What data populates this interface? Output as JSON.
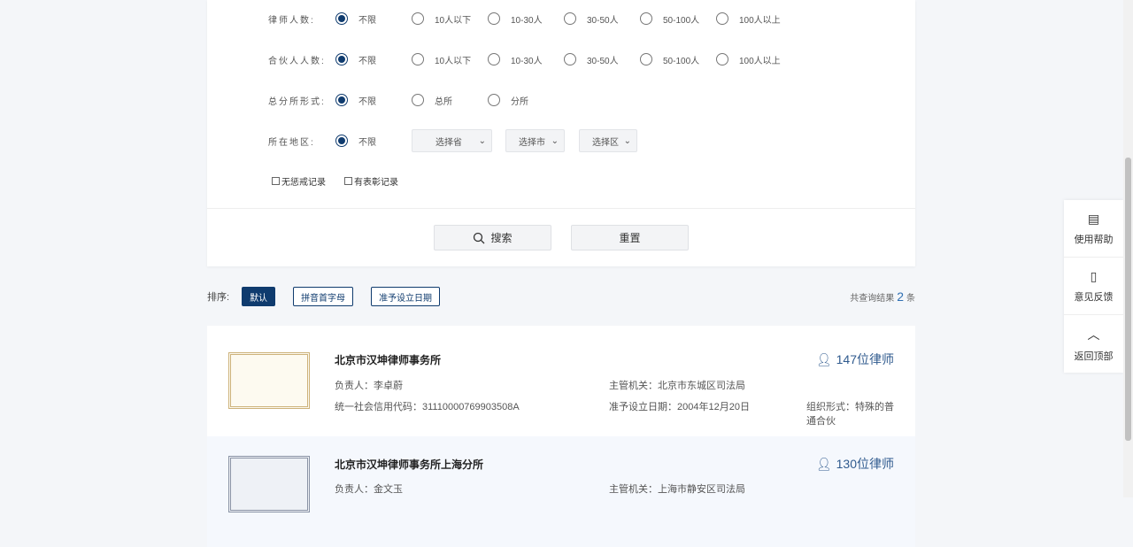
{
  "filters": [
    {
      "label": "律师人数:",
      "options": [
        "不限",
        "10人以下",
        "10-30人",
        "30-50人",
        "50-100人",
        "100人以上"
      ]
    },
    {
      "label": "合伙人人数:",
      "options": [
        "不限",
        "10人以下",
        "10-30人",
        "30-50人",
        "50-100人",
        "100人以上"
      ]
    },
    {
      "label": "总分所形式:",
      "options": [
        "不限",
        "总所",
        "分所"
      ]
    }
  ],
  "region": {
    "label": "所在地区:",
    "option": "不限",
    "province": "选择省",
    "city": "选择市",
    "district": "选择区"
  },
  "checks": [
    "无惩戒记录",
    "有表彰记录"
  ],
  "search_label": "搜索",
  "reset_label": "重置",
  "sort": {
    "label": "排序:",
    "options": [
      "默认",
      "拼音首字母",
      "准予设立日期"
    ],
    "total_prefix": "共查询结果",
    "total": "2",
    "total_suffix": "条"
  },
  "results": [
    {
      "name": "北京市汉坤律师事务所",
      "lawyers": "147位律师",
      "head": "负责人：李卓蔚",
      "authority": "主管机关：北京市东城区司法局",
      "code": "统一社会信用代码：31110000769903508A",
      "date": "准予设立日期：2004年12月20日",
      "form": "组织形式：特殊的普通合伙"
    },
    {
      "name": "北京市汉坤律师事务所上海分所",
      "lawyers": "130位律师",
      "head": "负责人：金文玉",
      "authority": "主管机关：上海市静安区司法局"
    }
  ],
  "side": [
    "使用帮助",
    "意见反馈",
    "返回顶部"
  ]
}
